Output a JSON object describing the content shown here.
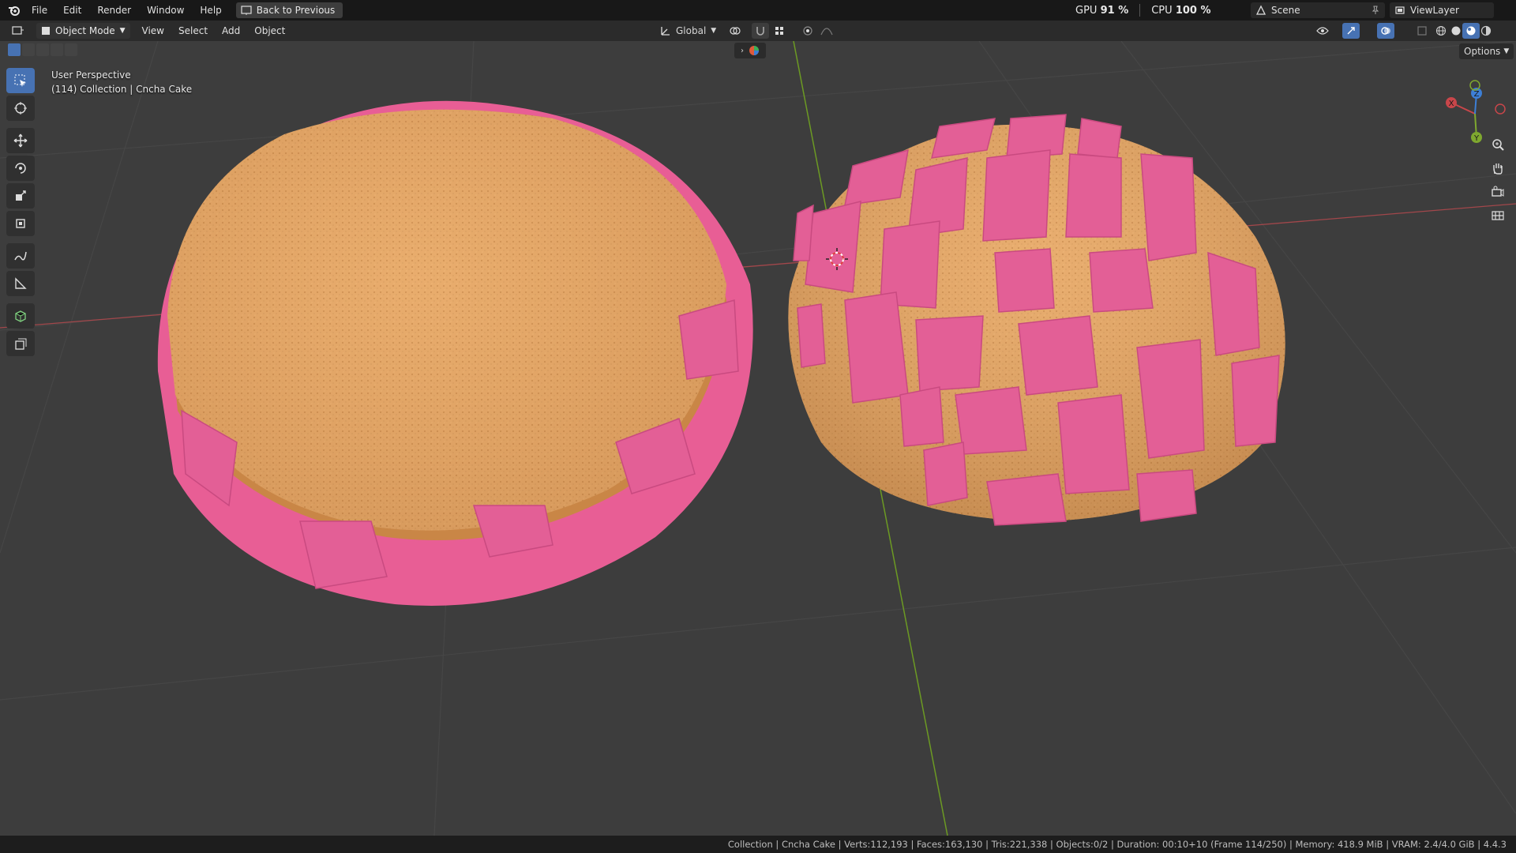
{
  "topbar": {
    "menus": [
      "File",
      "Edit",
      "Render",
      "Window",
      "Help"
    ],
    "back_button": "Back to Previous",
    "gpu_label": "GPU",
    "gpu_value": "91 %",
    "cpu_label": "CPU",
    "cpu_value": "100 %",
    "scene": "Scene",
    "view_layer": "ViewLayer"
  },
  "header": {
    "mode": "Object Mode",
    "menus": [
      "View",
      "Select",
      "Add",
      "Object"
    ],
    "transform_orientation": "Global",
    "options": "Options"
  },
  "viewport": {
    "perspective": "User Perspective",
    "collection_line": "(114) Collection | Cncha Cake",
    "gizmo": {
      "x": "X",
      "y": "Y",
      "z": "Z"
    }
  },
  "status_bar": "Collection | Cncha Cake | Verts:112,193 | Faces:163,130 | Tris:221,338 | Objects:0/2 | Duration: 00:10+10 (Frame 114/250) | Memory: 418.9 MiB | VRAM: 2.4/4.0 GiB | 4.4.3",
  "colors": {
    "accent": "#4772b3",
    "bread": "#e6a868",
    "topping": "#e85e95",
    "axis_x": "#c8464a",
    "axis_y": "#7fa82f",
    "axis_z": "#3d7fd6"
  }
}
